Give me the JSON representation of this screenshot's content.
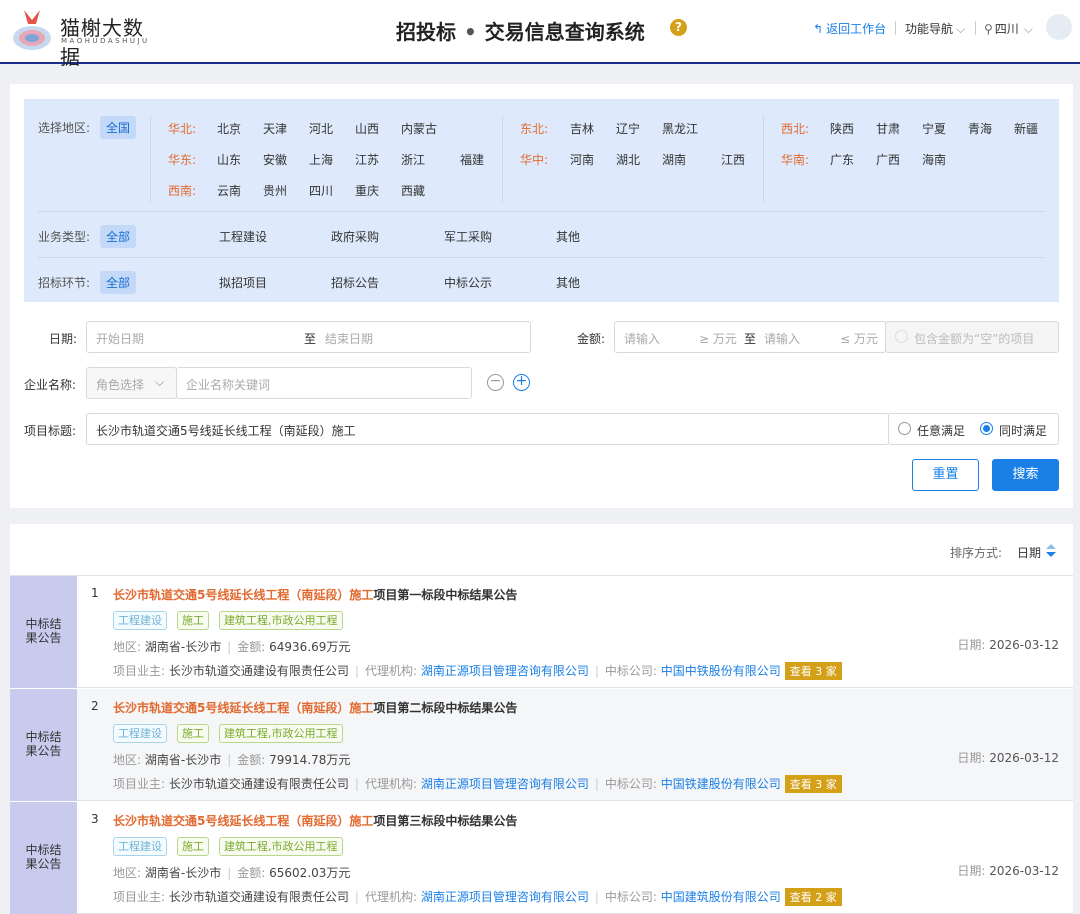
{
  "header": {
    "logo_name": "猫榭大数据",
    "logo_sub": "MAOHUDASHUJU",
    "title_a": "招投标",
    "title_dot": "•",
    "title_b": "交易信息查询系统",
    "help": "?",
    "back": "返回工作台",
    "nav": "功能导航",
    "region": "四川",
    "accent": "#1a2d8c"
  },
  "filters": {
    "area_label": "选择地区:",
    "area_all": "全国",
    "regions": [
      {
        "name": "华北:",
        "items": [
          "北京",
          "天津",
          "河北",
          "山西",
          "内蒙古"
        ]
      },
      {
        "name": "华东:",
        "items": [
          "山东",
          "安徽",
          "上海",
          "江苏",
          "浙江",
          "福建"
        ]
      },
      {
        "name": "西南:",
        "items": [
          "云南",
          "贵州",
          "四川",
          "重庆",
          "西藏"
        ]
      },
      {
        "name": "东北:",
        "items": [
          "吉林",
          "辽宁",
          "黑龙江"
        ]
      },
      {
        "name": "华中:",
        "items": [
          "河南",
          "湖北",
          "湖南",
          "江西"
        ]
      },
      {
        "name": "西北:",
        "items": [
          "陕西",
          "甘肃",
          "宁夏",
          "青海",
          "新疆"
        ]
      },
      {
        "name": "华南:",
        "items": [
          "广东",
          "广西",
          "海南"
        ]
      }
    ],
    "biz_label": "业务类型:",
    "biz_all": "全部",
    "biz_items": [
      "工程建设",
      "政府采购",
      "军工采购",
      "其他"
    ],
    "stage_label": "招标环节:",
    "stage_all": "全部",
    "stage_items": [
      "拟招项目",
      "招标公告",
      "中标公示",
      "其他"
    ]
  },
  "form": {
    "date_label": "日期:",
    "date_start": "开始日期",
    "date_to": "至",
    "date_end": "结束日期",
    "amount_label": "金额:",
    "amount_min": "请输入",
    "amount_min_unit": "≥ 万元",
    "amount_to": "至",
    "amount_max": "请输入",
    "amount_max_unit": "≤ 万元",
    "include_empty": "包含金额为“空”的项目",
    "company_label": "企业名称:",
    "role_select": "角色选择",
    "company_ph": "企业名称关键词",
    "title_label": "项目标题:",
    "title_value": "长沙市轨道交通5号线延长线工程（南延段）施工",
    "any": "任意满足",
    "all": "同时满足",
    "reset": "重置",
    "search": "搜索"
  },
  "results": {
    "sort_label": "排序方式:",
    "sort_value": "日期",
    "items": [
      {
        "label": "中标结果公告",
        "num": "1",
        "title_hl": "长沙市轨道交通5号线延长线工程（南延段）施工",
        "title_rest": "项目第一标段中标结果公告",
        "tags": [
          "工程建设",
          "施工",
          "建筑工程,市政公用工程"
        ],
        "area_label": "地区:",
        "area": "湖南省-长沙市",
        "amount_label": "金额:",
        "amount": "64936.69万元",
        "owner_label": "项目业主:",
        "owner": "长沙市轨道交通建设有限责任公司",
        "agent_label": "代理机构:",
        "agent": "湖南正源项目管理咨询有限公司",
        "winner_label": "中标公司:",
        "winner": "中国中铁股份有限公司",
        "see": "查看 3 家",
        "date_label": "日期:",
        "date": "2026-03-12"
      },
      {
        "label": "中标结果公告",
        "num": "2",
        "title_hl": "长沙市轨道交通5号线延长线工程（南延段）施工",
        "title_rest": "项目第二标段中标结果公告",
        "tags": [
          "工程建设",
          "施工",
          "建筑工程,市政公用工程"
        ],
        "area_label": "地区:",
        "area": "湖南省-长沙市",
        "amount_label": "金额:",
        "amount": "79914.78万元",
        "owner_label": "项目业主:",
        "owner": "长沙市轨道交通建设有限责任公司",
        "agent_label": "代理机构:",
        "agent": "湖南正源项目管理咨询有限公司",
        "winner_label": "中标公司:",
        "winner": "中国铁建股份有限公司",
        "see": "查看 3 家",
        "date_label": "日期:",
        "date": "2026-03-12"
      },
      {
        "label": "中标结果公告",
        "num": "3",
        "title_hl": "长沙市轨道交通5号线延长线工程（南延段）施工",
        "title_rest": "项目第三标段中标结果公告",
        "tags": [
          "工程建设",
          "施工",
          "建筑工程,市政公用工程"
        ],
        "area_label": "地区:",
        "area": "湖南省-长沙市",
        "amount_label": "金额:",
        "amount": "65602.03万元",
        "owner_label": "项目业主:",
        "owner": "长沙市轨道交通建设有限责任公司",
        "agent_label": "代理机构:",
        "agent": "湖南正源项目管理咨询有限公司",
        "winner_label": "中标公司:",
        "winner": "中国建筑股份有限公司",
        "see": "查看 2 家",
        "date_label": "日期:",
        "date": "2026-03-12"
      }
    ]
  }
}
